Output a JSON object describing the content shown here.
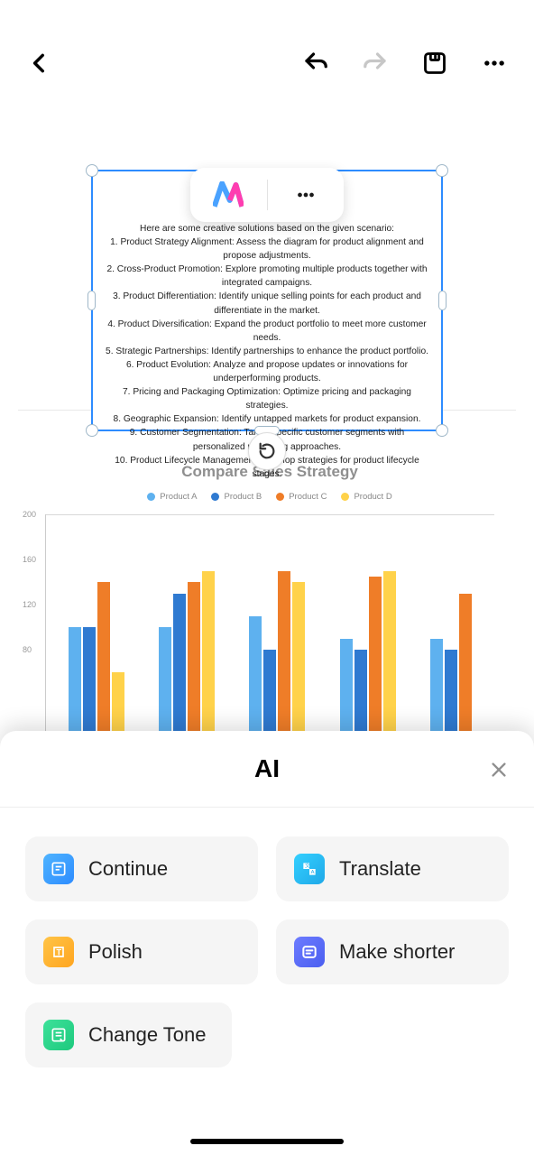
{
  "colors": {
    "productA": "#5eb1ef",
    "productB": "#2f7ad1",
    "productC": "#ef7d28",
    "productD": "#ffd24a"
  },
  "textbox": {
    "intro": "Here are some creative solutions based on the given scenario:",
    "lines": [
      "1. Product Strategy Alignment: Assess the diagram for product alignment and propose adjustments.",
      "2. Cross-Product Promotion: Explore promoting multiple products together with integrated campaigns.",
      "3. Product Differentiation: Identify unique selling points for each product and differentiate in the market.",
      "4. Product Diversification: Expand the product portfolio to meet more customer needs.",
      "5. Strategic Partnerships: Identify partnerships to enhance the product portfolio.",
      "6. Product Evolution: Analyze and propose updates or innovations for underperforming products.",
      "7. Pricing and Packaging Optimization: Optimize pricing and packaging strategies.",
      "8. Geographic Expansion: Identify untapped markets for product expansion.",
      "9. Customer Segmentation: Target specific customer segments with personalized marketing approaches.",
      "10. Product Lifecycle Management: Develop strategies for product lifecycle stages."
    ]
  },
  "chart_data": {
    "type": "bar",
    "title": "Compare Sales Strategy",
    "ylim": [
      0,
      200
    ],
    "yticks": [
      80,
      120,
      160,
      200
    ],
    "legend": [
      "Product A",
      "Product B",
      "Product C",
      "Product D"
    ],
    "categories": [
      "",
      "",
      "",
      "",
      ""
    ],
    "series": [
      {
        "name": "Product A",
        "color": "#5eb1ef",
        "values": [
          100,
          100,
          110,
          90,
          90
        ]
      },
      {
        "name": "Product B",
        "color": "#2f7ad1",
        "values": [
          100,
          130,
          80,
          80,
          80
        ]
      },
      {
        "name": "Product C",
        "color": "#ef7d28",
        "values": [
          140,
          140,
          150,
          145,
          130
        ]
      },
      {
        "name": "Product D",
        "color": "#ffd24a",
        "values": [
          60,
          150,
          140,
          150,
          null
        ]
      }
    ]
  },
  "ai": {
    "title": "AI",
    "buttons": {
      "continue": "Continue",
      "translate": "Translate",
      "polish": "Polish",
      "shorter": "Make shorter",
      "tone": "Change Tone"
    }
  }
}
